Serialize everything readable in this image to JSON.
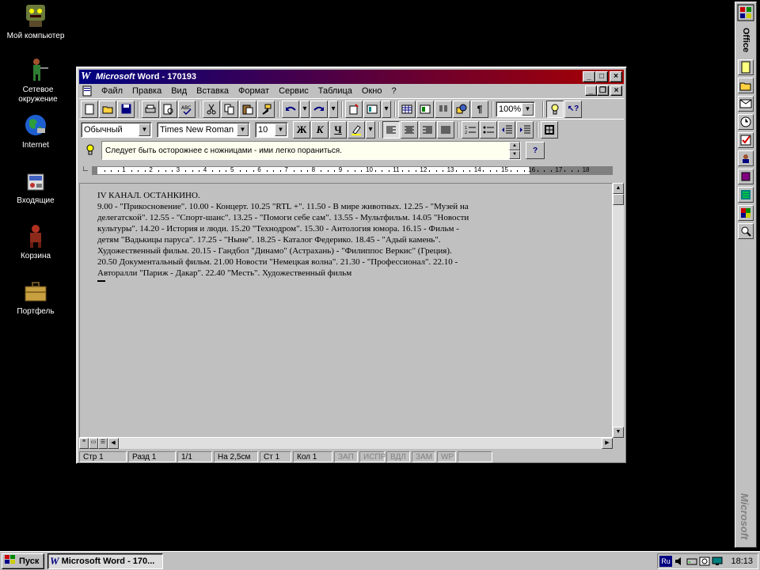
{
  "desktop": {
    "icons": [
      {
        "label": "Мой компьютер"
      },
      {
        "label": "Сетевое окружение"
      },
      {
        "label": "Internet"
      },
      {
        "label": "Входящие"
      },
      {
        "label": "Корзина"
      },
      {
        "label": "Портфель"
      }
    ]
  },
  "window": {
    "title_brand": "Microsoft",
    "title_rest": " Word - 170193",
    "menu": [
      "Файл",
      "Правка",
      "Вид",
      "Вставка",
      "Формат",
      "Сервис",
      "Таблица",
      "Окно",
      "?"
    ],
    "zoom": "100%",
    "style": "Обычный",
    "font": "Times New Roman",
    "size": "10",
    "bold_label": "Ж",
    "italic_label": "К",
    "underline_label": "Ч",
    "tip": "Следует быть осторожнее с ножницами - ими легко пораниться.",
    "document_lines": [
      "IV КАНАЛ. ОСТАНКИНО.",
      "9.00 - \"Прикосновение\". 10.00 - Концерт. 10.25 \"RTL +\". 11.50 - В мире животных. 12.25 - \"Музей на",
      "делегатской\". 12.55 - \"Спорт-шанс\". 13.25 - \"Помоги себе сам\". 13.55 - Мультфильм. 14.05 \"Новости",
      "культуры\". 14.20 - История и люди. 15.20 \"Технодром\". 15.30 - Антология юмора. 16.15 - Фильм -",
      "детям \"Вадькицы паруса\". 17.25 - \"Ныне\". 18.25 - Каталог Федерико. 18.45 - \"Адый камень\".",
      "Художественный фильм. 20.15 - Гандбол \"Динамо\" (Астрахань) - \"Филиппос Веркис\" (Греция).",
      "20.50 Документальный фильм. 21.00 Новости \"Немецкая волна\". 21.30 - \"Профессионал\". 22.10 -",
      "Авторалли \"Париж - Дакар\". 22.40 \"Месть\". Художественный фильм"
    ],
    "ruler_numbers": [
      "1",
      "2",
      "3",
      "4",
      "5",
      "6",
      "7",
      "8",
      "9",
      "10",
      "11",
      "12",
      "13",
      "14",
      "15",
      "16",
      "17",
      "18"
    ],
    "status": {
      "page": "Стр 1",
      "section": "Разд 1",
      "pages": "1/1",
      "at": "На 2,5см",
      "line": "Ст 1",
      "col": "Кол 1",
      "rec": "ЗАП",
      "trk": "ИСПР",
      "ext": "ВДЛ",
      "ovr": "ЗАМ",
      "wph": "WP"
    }
  },
  "office_bar": {
    "title": "Office",
    "brand": "Microsoft"
  },
  "taskbar": {
    "start": "Пуск",
    "task": "Microsoft Word - 170...",
    "lang": "Ru",
    "clock": "18:13"
  }
}
